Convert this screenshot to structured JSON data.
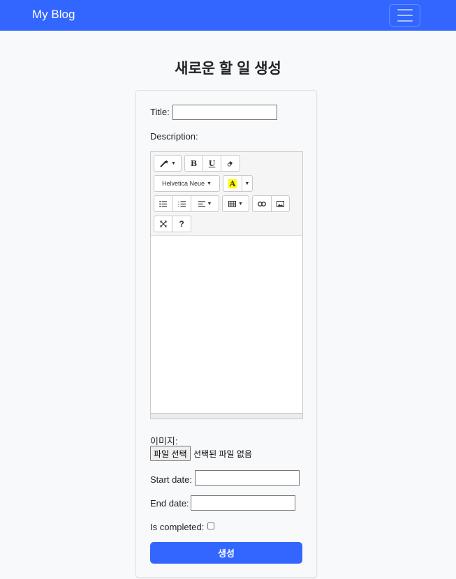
{
  "navbar": {
    "brand": "My Blog",
    "toggler_icon": "hamburger-icon"
  },
  "page": {
    "title": "새로운 할 일 생성"
  },
  "form": {
    "title_label": "Title:",
    "title_value": "",
    "description_label": "Description:",
    "editor": {
      "font_name": "Helvetica Neue",
      "buttons": [
        "magic-style",
        "bold",
        "underline",
        "eraser",
        "font-name",
        "forecolor",
        "unordered-list",
        "ordered-list",
        "paragraph-align",
        "table",
        "link",
        "picture",
        "fullscreen",
        "help"
      ],
      "bold_label": "B",
      "underline_label": "U",
      "color_label": "A",
      "help_label": "?",
      "highlight_color": "#ffff00"
    },
    "image_label": "이미지:",
    "file_button": "파일 선택",
    "file_status": "선택된 파일 없음",
    "start_date_label": "Start date:",
    "start_date_value": "",
    "end_date_label": "End date:",
    "end_date_value": "",
    "completed_label": "Is completed:",
    "completed_checked": false,
    "submit_label": "생성"
  },
  "colors": {
    "primary": "#3366ff",
    "background": "#f8f9fa"
  }
}
